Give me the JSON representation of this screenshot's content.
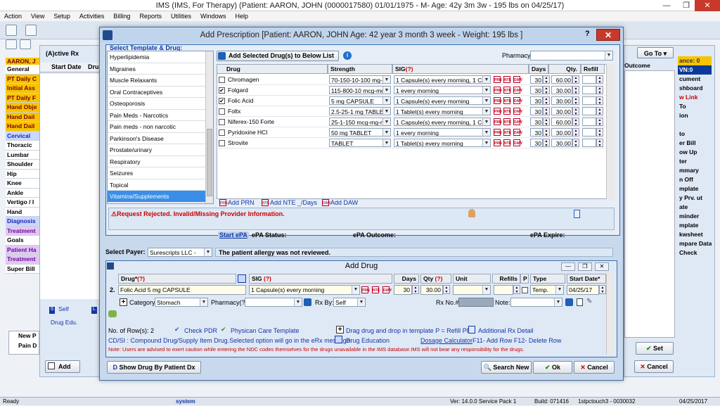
{
  "window": {
    "title": "IMS (IMS, For Therapy)    (Patient: AARON, JOHN  (0000017580) 01/01/1975 - M- Age: 42y 3m 3w - 195 lbs on 04/25/17)"
  },
  "menu": [
    "Action",
    "View",
    "Setup",
    "Activities",
    "Billing",
    "Reports",
    "Utilities",
    "Windows",
    "Help"
  ],
  "bg": {
    "active_rx": "(A)ctive Rx",
    "col_start_date": "Start Date",
    "col_drug": "Drug",
    "col_outcome": "Outcome",
    "patient": "AARON, J",
    "goto": "Go To",
    "left_nav": [
      {
        "label": "General",
        "style": "w"
      },
      {
        "label": "PT Daily C",
        "style": "y"
      },
      {
        "label": "Initial Ass",
        "style": "y"
      },
      {
        "label": "PT Daily F",
        "style": "y"
      },
      {
        "label": "Hand Obje",
        "style": "y"
      },
      {
        "label": "Hand Dail",
        "style": "y"
      },
      {
        "label": "Hand Dail",
        "style": "y"
      },
      {
        "label": "Cervical",
        "style": "b"
      },
      {
        "label": "Thoracic",
        "style": "w"
      },
      {
        "label": "Lumbar",
        "style": "w"
      },
      {
        "label": "Shoulder",
        "style": "w"
      },
      {
        "label": "Hip",
        "style": "w"
      },
      {
        "label": "Knee",
        "style": "w"
      },
      {
        "label": "Ankle",
        "style": "w"
      },
      {
        "label": "Vertigo / I",
        "style": "w"
      },
      {
        "label": "Hand",
        "style": "w"
      },
      {
        "label": "Diagnosis",
        "style": "b"
      },
      {
        "label": "Treatment",
        "style": "p"
      },
      {
        "label": "Goals",
        "style": "w"
      },
      {
        "label": "Patient Ha",
        "style": "p"
      },
      {
        "label": "Treatment",
        "style": "p"
      },
      {
        "label": "Super Bill",
        "style": "w"
      }
    ],
    "self": "Self",
    "drug_edu": "Drug Edu.",
    "new_p": "New P",
    "pain_d": "Pain D",
    "add": "Add",
    "right_nav": [
      "ance: 0",
      "VN:0",
      "cument",
      "shboard",
      "w Link",
      "To",
      "ion",
      "",
      "to",
      "er Bill",
      "ow Up",
      "ter",
      "mmary",
      "n Off",
      "mplate",
      "y Prv. ut",
      "ate",
      "minder",
      "mplate",
      "kwsheet",
      "mpare Data",
      "Check"
    ],
    "set": "Set",
    "cancel": "Cancel"
  },
  "dialog": {
    "title": "Add Prescription  [Patient: AARON, JOHN  Age: 42 year 3 month 3 week - Weight: 195 lbs ]",
    "help": "?",
    "close": "✕",
    "template_label": "Select Template & Drug:",
    "templates": [
      "Hyperlipidemia",
      "Migraines",
      "Muscle Relaxants",
      "Oral Contraceptives",
      "Osteoporosis",
      "Pain Meds - Narcotics",
      "Pain meds - non narcotic",
      "Parkinson's Disease",
      "Prostate/urinary",
      "Respiratory",
      "Seizures",
      "Topical",
      "Vitamins/Supplements"
    ],
    "selected_template": "Vitamins/Supplements",
    "add_selected": "Add Selected Drug(s) to Below List",
    "pharmacy_label": "Pharmacy:",
    "cols": {
      "drug": "Drug",
      "strength": "Strength",
      "sig": "SIG",
      "sig_q": "(?)",
      "days": "Days",
      "qty": "Qty.",
      "refill": "Refill"
    },
    "drugs": [
      {
        "checked": false,
        "drug": "Chromagen",
        "strength": "70-150-10-100 mg-m",
        "sig": "1 Capsule(s) every morning,  1 Cap",
        "days": "30",
        "qty": "60.00"
      },
      {
        "checked": true,
        "drug": "Folgard",
        "strength": "115-800-10 mcg-mcg",
        "sig": "1 every morning",
        "days": "30",
        "qty": "30.00"
      },
      {
        "checked": true,
        "drug": "Folic Acid",
        "strength": "5 mg CAPSULE",
        "sig": "1 Capsule(s) every morning",
        "days": "30",
        "qty": "30.00"
      },
      {
        "checked": false,
        "drug": "Foltx",
        "strength": "2.5-25-1 mg TABLET",
        "sig": "1 Tablet(s) every morning",
        "days": "30",
        "qty": "30.00"
      },
      {
        "checked": false,
        "drug": "Niferex-150 Forte",
        "strength": "25-1-150 mcg-mg-mc",
        "sig": "1 Capsule(s) every morning,  1 Cap",
        "days": "30",
        "qty": "60.00"
      },
      {
        "checked": false,
        "drug": "Pyridoxine HCl",
        "strength": "50 mg TABLET",
        "sig": "1 every morning",
        "days": "30",
        "qty": "30.00"
      },
      {
        "checked": false,
        "drug": "Strovite",
        "strength": " TABLET",
        "sig": "1 Tablet(s) every morning",
        "days": "30",
        "qty": "30.00"
      }
    ],
    "add_prn": "Add PRN",
    "add_nte": "Add NTE _/Days",
    "add_daw": "Add DAW",
    "error": "Request Rejected. Invalid/Missing Provider Information.",
    "start_epa": "Start ePA",
    "epa_status": "ePA Status:",
    "epa_outcome": "ePA Outcome:",
    "epa_expire": "ePA Expire:",
    "payer_label": "Select Payer:",
    "payer_value": "Surescripts LLC -",
    "allergy": "The patient allergy was not reviewed.",
    "add_drug": {
      "title": "Add Drug",
      "cols": {
        "drug": "Drug*",
        "drug_q": "(?)",
        "sig": "SIG",
        "sig_q": "(?)",
        "days": "Days",
        "qty": "Qty",
        "qty_q": "(?)",
        "unit": "Unit",
        "refills": "Refills",
        "p": "P",
        "type": "Type",
        "start_date": "Start Date*"
      },
      "row_num": "2.",
      "drug": "Folic Acid 5 mg CAPSULE",
      "sig": "1 Capsule(s) every morning",
      "days": "30",
      "qty": "30.00",
      "type": "Temp.",
      "start_date": "04/25/17",
      "category_label": "Category:",
      "category": "Stomach",
      "pharmacy_label": "Pharmacy(?)",
      "rxby_label": "Rx By:",
      "rxby": "Self",
      "rxno_label": "Rx No.#",
      "note_label": "Note:",
      "rows_count": "No. of Row(s): 2",
      "check_pdr": "Check PDR",
      "phys_template": "Physican Care Template",
      "drag_note": "Drag drug and drop in template  P = Refill PRN",
      "additional": "Additional Rx Detail",
      "cdsi": "CD/SI : Compound Drug/Supply Item Drug.Selected option will go in the eRx message.",
      "drug_education": "Drug Education",
      "dosage_calc": "Dosage Calculator",
      "f11": "F11- Add Row  F12- Delete Row",
      "note": "Note: Users are advised to exert caution while entering the NDC codes themselves for the drugs unavailable in the IMS database.IMS will not bear any responsibility for the drugs."
    },
    "show_drug": "Show Drug By Patient Dx",
    "search_new": "Search New",
    "ok": "Ok",
    "cancel": "Cancel"
  },
  "status": {
    "ready": "Ready",
    "user": "system",
    "version": "Ver: 14.0.0 Service Pack 1",
    "build": "Build: 071416",
    "session": "1stpctouch3 - 0030032",
    "date": "04/25/2017"
  }
}
